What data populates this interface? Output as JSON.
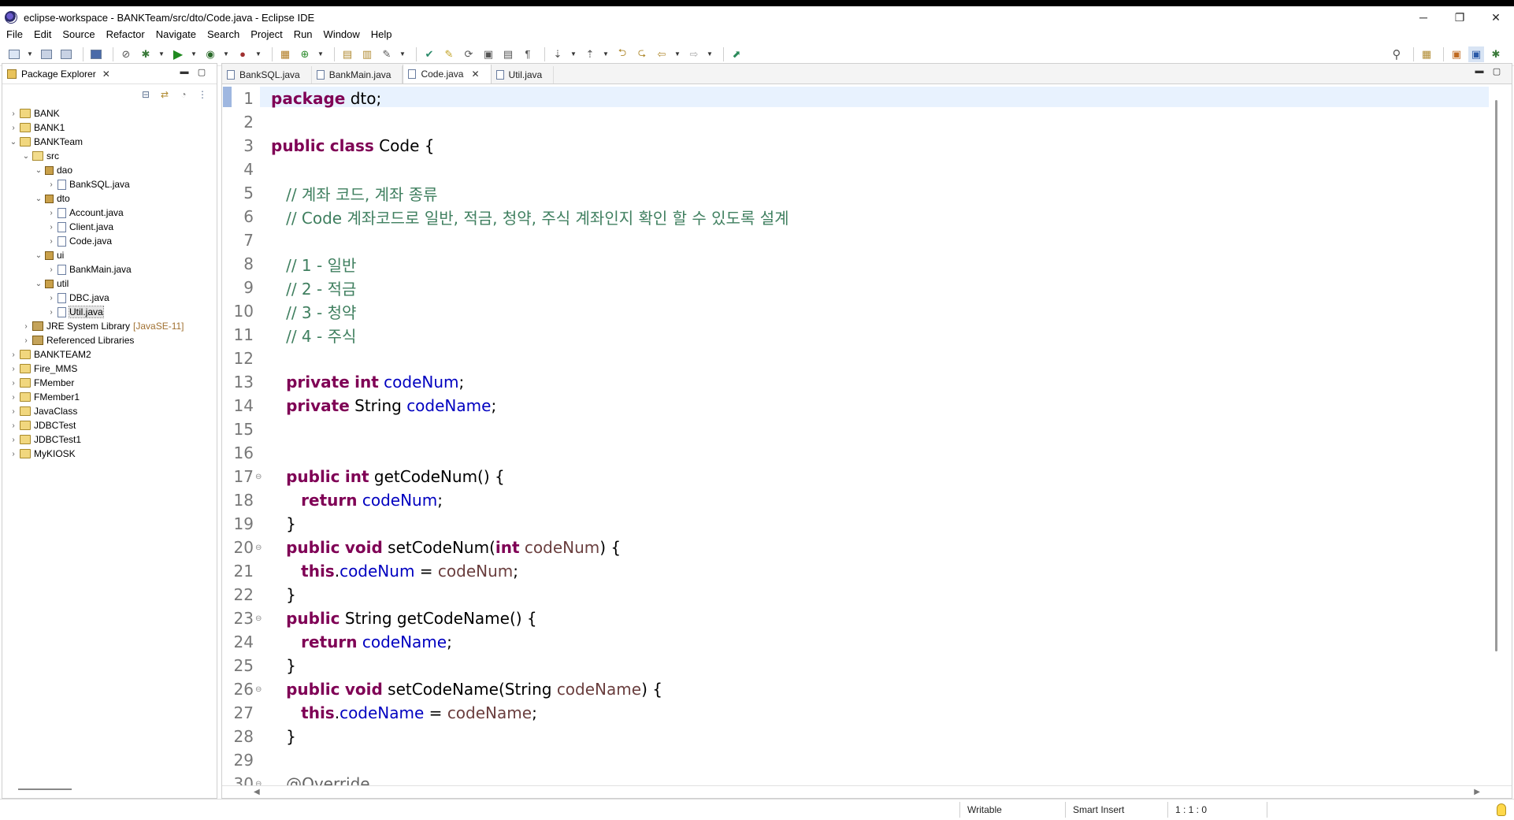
{
  "window": {
    "title": "eclipse-workspace - BANKTeam/src/dto/Code.java - Eclipse IDE",
    "controls": [
      "─",
      "❐",
      "✕"
    ]
  },
  "menu": [
    "File",
    "Edit",
    "Source",
    "Refactor",
    "Navigate",
    "Search",
    "Project",
    "Run",
    "Window",
    "Help"
  ],
  "package_explorer": {
    "title": "Package Explorer",
    "tree": [
      {
        "label": "BANK",
        "type": "project",
        "depth": 0,
        "twisty": "›"
      },
      {
        "label": "BANK1",
        "type": "project",
        "depth": 0,
        "twisty": "›"
      },
      {
        "label": "BANKTeam",
        "type": "project",
        "depth": 0,
        "twisty": "⌄"
      },
      {
        "label": "src",
        "type": "src",
        "depth": 1,
        "twisty": "⌄"
      },
      {
        "label": "dao",
        "type": "package",
        "depth": 2,
        "twisty": "⌄"
      },
      {
        "label": "BankSQL.java",
        "type": "java",
        "depth": 3,
        "twisty": "›"
      },
      {
        "label": "dto",
        "type": "package",
        "depth": 2,
        "twisty": "⌄"
      },
      {
        "label": "Account.java",
        "type": "java",
        "depth": 3,
        "twisty": "›"
      },
      {
        "label": "Client.java",
        "type": "java",
        "depth": 3,
        "twisty": "›"
      },
      {
        "label": "Code.java",
        "type": "java",
        "depth": 3,
        "twisty": "›"
      },
      {
        "label": "ui",
        "type": "package",
        "depth": 2,
        "twisty": "⌄"
      },
      {
        "label": "BankMain.java",
        "type": "java",
        "depth": 3,
        "twisty": "›"
      },
      {
        "label": "util",
        "type": "package",
        "depth": 2,
        "twisty": "⌄"
      },
      {
        "label": "DBC.java",
        "type": "java",
        "depth": 3,
        "twisty": "›"
      },
      {
        "label": "Util.java",
        "type": "java",
        "depth": 3,
        "twisty": "›",
        "selected": true
      },
      {
        "label": "JRE System Library",
        "extra": "[JavaSE-11]",
        "type": "lib",
        "depth": 1,
        "twisty": "›"
      },
      {
        "label": "Referenced Libraries",
        "type": "lib",
        "depth": 1,
        "twisty": "›"
      },
      {
        "label": "BANKTEAM2",
        "type": "project",
        "depth": 0,
        "twisty": "›"
      },
      {
        "label": "Fire_MMS",
        "type": "project",
        "depth": 0,
        "twisty": "›"
      },
      {
        "label": "FMember",
        "type": "project",
        "depth": 0,
        "twisty": "›"
      },
      {
        "label": "FMember1",
        "type": "project",
        "depth": 0,
        "twisty": "›"
      },
      {
        "label": "JavaClass",
        "type": "project",
        "depth": 0,
        "twisty": "›"
      },
      {
        "label": "JDBCTest",
        "type": "project",
        "depth": 0,
        "twisty": "›"
      },
      {
        "label": "JDBCTest1",
        "type": "project",
        "depth": 0,
        "twisty": "›"
      },
      {
        "label": "MyKIOSK",
        "type": "project",
        "depth": 0,
        "twisty": "›"
      }
    ]
  },
  "editor": {
    "tabs": [
      {
        "label": "BankSQL.java",
        "active": false
      },
      {
        "label": "BankMain.java",
        "active": false
      },
      {
        "label": "Code.java",
        "active": true
      },
      {
        "label": "Util.java",
        "active": false
      }
    ],
    "lines": [
      {
        "n": "1",
        "fold": false,
        "tokens": [
          [
            "kw",
            "package"
          ],
          [
            "",
            " dto;"
          ]
        ]
      },
      {
        "n": "2",
        "fold": false,
        "tokens": []
      },
      {
        "n": "3",
        "fold": false,
        "tokens": [
          [
            "kw",
            "public"
          ],
          [
            "",
            " "
          ],
          [
            "kw",
            "class"
          ],
          [
            "",
            " Code {"
          ]
        ]
      },
      {
        "n": "4",
        "fold": false,
        "tokens": []
      },
      {
        "n": "5",
        "fold": false,
        "tokens": [
          [
            "",
            "   "
          ],
          [
            "cm",
            "// 계좌 코드, 계좌 종류"
          ]
        ]
      },
      {
        "n": "6",
        "fold": false,
        "tokens": [
          [
            "",
            "   "
          ],
          [
            "cm",
            "// Code 계좌코드로 일반, 적금, 청약, 주식 계좌인지 확인 할 수 있도록 설계"
          ]
        ]
      },
      {
        "n": "7",
        "fold": false,
        "tokens": []
      },
      {
        "n": "8",
        "fold": false,
        "tokens": [
          [
            "",
            "   "
          ],
          [
            "cm",
            "// 1 - 일반"
          ]
        ]
      },
      {
        "n": "9",
        "fold": false,
        "tokens": [
          [
            "",
            "   "
          ],
          [
            "cm",
            "// 2 - 적금"
          ]
        ]
      },
      {
        "n": "10",
        "fold": false,
        "tokens": [
          [
            "",
            "   "
          ],
          [
            "cm",
            "// 3 - 청약"
          ]
        ]
      },
      {
        "n": "11",
        "fold": false,
        "tokens": [
          [
            "",
            "   "
          ],
          [
            "cm",
            "// 4 - 주식"
          ]
        ]
      },
      {
        "n": "12",
        "fold": false,
        "tokens": []
      },
      {
        "n": "13",
        "fold": false,
        "tokens": [
          [
            "",
            "   "
          ],
          [
            "kw",
            "private"
          ],
          [
            "",
            " "
          ],
          [
            "kw",
            "int"
          ],
          [
            "",
            " "
          ],
          [
            "fld",
            "codeNum"
          ],
          [
            "",
            ";"
          ]
        ]
      },
      {
        "n": "14",
        "fold": false,
        "tokens": [
          [
            "",
            "   "
          ],
          [
            "kw",
            "private"
          ],
          [
            "",
            " String "
          ],
          [
            "fld",
            "codeName"
          ],
          [
            "",
            ";"
          ]
        ]
      },
      {
        "n": "15",
        "fold": false,
        "tokens": []
      },
      {
        "n": "16",
        "fold": false,
        "tokens": []
      },
      {
        "n": "17",
        "fold": true,
        "tokens": [
          [
            "",
            "   "
          ],
          [
            "kw",
            "public"
          ],
          [
            "",
            " "
          ],
          [
            "kw",
            "int"
          ],
          [
            "",
            " getCodeNum() {"
          ]
        ]
      },
      {
        "n": "18",
        "fold": false,
        "tokens": [
          [
            "",
            "      "
          ],
          [
            "kw",
            "return"
          ],
          [
            "",
            " "
          ],
          [
            "fld",
            "codeNum"
          ],
          [
            "",
            ";"
          ]
        ]
      },
      {
        "n": "19",
        "fold": false,
        "tokens": [
          [
            "",
            "   }"
          ]
        ]
      },
      {
        "n": "20",
        "fold": true,
        "tokens": [
          [
            "",
            "   "
          ],
          [
            "kw",
            "public"
          ],
          [
            "",
            " "
          ],
          [
            "kw",
            "void"
          ],
          [
            "",
            " setCodeNum("
          ],
          [
            "kw",
            "int"
          ],
          [
            "",
            " "
          ],
          [
            "prm",
            "codeNum"
          ],
          [
            "",
            ") {"
          ]
        ]
      },
      {
        "n": "21",
        "fold": false,
        "tokens": [
          [
            "",
            "      "
          ],
          [
            "kw",
            "this"
          ],
          [
            "",
            "."
          ],
          [
            "fld",
            "codeNum"
          ],
          [
            "",
            " = "
          ],
          [
            "prm",
            "codeNum"
          ],
          [
            "",
            ";"
          ]
        ]
      },
      {
        "n": "22",
        "fold": false,
        "tokens": [
          [
            "",
            "   }"
          ]
        ]
      },
      {
        "n": "23",
        "fold": true,
        "tokens": [
          [
            "",
            "   "
          ],
          [
            "kw",
            "public"
          ],
          [
            "",
            " String getCodeName() {"
          ]
        ]
      },
      {
        "n": "24",
        "fold": false,
        "tokens": [
          [
            "",
            "      "
          ],
          [
            "kw",
            "return"
          ],
          [
            "",
            " "
          ],
          [
            "fld",
            "codeName"
          ],
          [
            "",
            ";"
          ]
        ]
      },
      {
        "n": "25",
        "fold": false,
        "tokens": [
          [
            "",
            "   }"
          ]
        ]
      },
      {
        "n": "26",
        "fold": true,
        "tokens": [
          [
            "",
            "   "
          ],
          [
            "kw",
            "public"
          ],
          [
            "",
            " "
          ],
          [
            "kw",
            "void"
          ],
          [
            "",
            " setCodeName(String "
          ],
          [
            "prm",
            "codeName"
          ],
          [
            "",
            ") {"
          ]
        ]
      },
      {
        "n": "27",
        "fold": false,
        "tokens": [
          [
            "",
            "      "
          ],
          [
            "kw",
            "this"
          ],
          [
            "",
            "."
          ],
          [
            "fld",
            "codeName"
          ],
          [
            "",
            " = "
          ],
          [
            "prm",
            "codeName"
          ],
          [
            "",
            ";"
          ]
        ]
      },
      {
        "n": "28",
        "fold": false,
        "tokens": [
          [
            "",
            "   }"
          ]
        ]
      },
      {
        "n": "29",
        "fold": false,
        "tokens": []
      },
      {
        "n": "30",
        "fold": true,
        "tokens": [
          [
            "",
            "   "
          ],
          [
            "ann",
            "@Override"
          ]
        ]
      }
    ]
  },
  "status": {
    "writable": "Writable",
    "insert_mode": "Smart Insert",
    "position": "1 : 1 : 0"
  }
}
